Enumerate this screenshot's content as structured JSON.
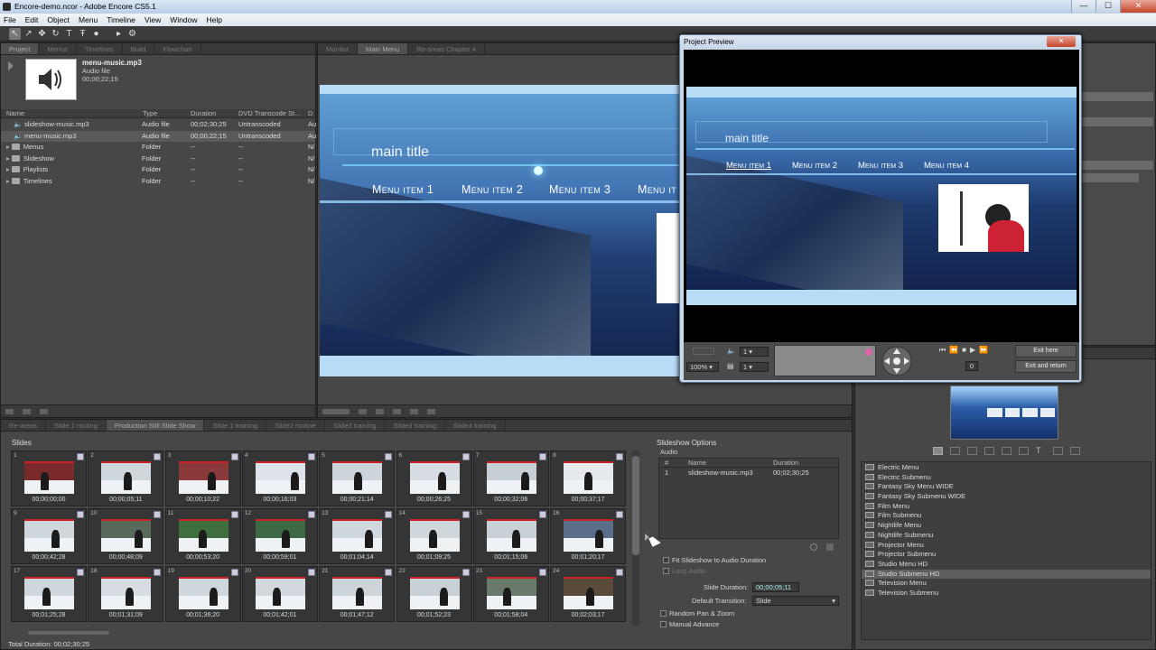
{
  "window": {
    "title": "Encore-demo.ncor - Adobe Encore CS5.1",
    "minimize": "—",
    "maximize": "☐",
    "close": "✕"
  },
  "menu": [
    "File",
    "Edit",
    "Object",
    "Menu",
    "Timeline",
    "View",
    "Window",
    "Help"
  ],
  "project_panel": {
    "tabs": [
      "Project",
      "Menus",
      "Timelines",
      "Build",
      "Flowchart"
    ],
    "selected": {
      "name": "menu-music.mp3",
      "type": "Audio file",
      "duration": "00;00;22;15"
    },
    "columns": [
      "Name",
      "Type",
      "Duration",
      "DVD Transcode St...",
      "D"
    ],
    "rows": [
      {
        "name": "slideshow-music.mp3",
        "type": "Audio file",
        "duration": "00;02;30;25",
        "transcode": "Untranscoded",
        "d": "Au",
        "icon": "speaker",
        "selected": false
      },
      {
        "name": "menu-music.mp3",
        "type": "Audio file",
        "duration": "00;00;22;15",
        "transcode": "Untranscoded",
        "d": "Au",
        "icon": "speaker",
        "selected": true
      },
      {
        "name": "Menus",
        "type": "Folder",
        "duration": "--",
        "transcode": "--",
        "d": "N/",
        "icon": "folder",
        "selected": false
      },
      {
        "name": "Slideshow",
        "type": "Folder",
        "duration": "--",
        "transcode": "--",
        "d": "N/",
        "icon": "folder",
        "selected": false
      },
      {
        "name": "Playlists",
        "type": "Folder",
        "duration": "--",
        "transcode": "--",
        "d": "N/",
        "icon": "folder",
        "selected": false
      },
      {
        "name": "Timelines",
        "type": "Folder",
        "duration": "--",
        "transcode": "--",
        "d": "N/",
        "icon": "folder",
        "selected": false
      }
    ]
  },
  "monitor_panel": {
    "tabs": [
      "Monitor",
      "Main Menu",
      "Re-areas Chapter 4"
    ],
    "menu_title": "main title",
    "menu_items": [
      "Menu item 1",
      "Menu item 2",
      "Menu item 3",
      "Menu it"
    ]
  },
  "project_preview": {
    "title": "Project Preview",
    "close": "✕",
    "menu_title": "main title",
    "menu_items": [
      "Menu item 1",
      "Menu item 2",
      "Menu item 3",
      "Menu item 4"
    ],
    "zoom": "100%",
    "audio_track": "1",
    "subtitle_track": "1",
    "chapter": "0",
    "exit_here": "Exit here",
    "exit_return": "Exit and return"
  },
  "slideshow_panel": {
    "tabs": [
      "Re-areas",
      "Slide 1 routing",
      "Production Still Slide Show",
      "Slide 1 training",
      "Slide2 routine",
      "Slide2 training",
      "Slide3 training",
      "Slide4 training"
    ],
    "heading": "Slides",
    "slides": [
      {
        "n": "1",
        "tc": "00;00;00;00"
      },
      {
        "n": "2",
        "tc": "00;00;05;11"
      },
      {
        "n": "3",
        "tc": "00;00;10;22"
      },
      {
        "n": "4",
        "tc": "00;00;16;03"
      },
      {
        "n": "5",
        "tc": "00;00;21;14"
      },
      {
        "n": "6",
        "tc": "00;00;26;25"
      },
      {
        "n": "7",
        "tc": "00;00;32;06"
      },
      {
        "n": "8",
        "tc": "00;00;37;17"
      },
      {
        "n": "9",
        "tc": "00;00;42;28"
      },
      {
        "n": "10",
        "tc": "00;00;48;09"
      },
      {
        "n": "11",
        "tc": "00;00;53;20"
      },
      {
        "n": "12",
        "tc": "00;00;59;01"
      },
      {
        "n": "13",
        "tc": "00;01;04;14"
      },
      {
        "n": "14",
        "tc": "00;01;09;25"
      },
      {
        "n": "15",
        "tc": "00;01;15;06"
      },
      {
        "n": "16",
        "tc": "00;01;20;17"
      },
      {
        "n": "17",
        "tc": "00;01;25;28"
      },
      {
        "n": "18",
        "tc": "00;01;31;09"
      },
      {
        "n": "19",
        "tc": "00;01;36;20"
      },
      {
        "n": "20",
        "tc": "00;01;42;01"
      },
      {
        "n": "21",
        "tc": "00;01;47;12"
      },
      {
        "n": "22",
        "tc": "00;01;52;23"
      },
      {
        "n": "23",
        "tc": "00;01;58;04"
      },
      {
        "n": "24",
        "tc": "00;02;03;17"
      }
    ],
    "total_duration": "Total Duration: 00;02;30;25",
    "options": {
      "title": "Slideshow Options",
      "audio_label": "Audio",
      "columns": [
        "#",
        "Name",
        "Duration"
      ],
      "audio_rows": [
        {
          "n": "1",
          "name": "slideshow-music.mp3",
          "duration": "00;02;30;25"
        }
      ],
      "fit_label": "Fit Slideshow to Audio Duration",
      "loop_label": "Loop Audio",
      "slide_duration_label": "Slide Duration:",
      "slide_duration": "00;00;05;11",
      "default_transition_label": "Default Transition:",
      "default_transition": "Slide",
      "random_pan_label": "Random Pan & Zoom",
      "manual_advance_label": "Manual Advance"
    }
  },
  "library_panel": {
    "items": [
      "Electric Menu",
      "Electric Submenu",
      "Fantasy Sky Menu WIDE",
      "Fantasy Sky Submenu WIDE",
      "Film Menu",
      "Film Submenu",
      "Nightlife Menu",
      "Nightlife Submenu",
      "Projector Menu",
      "Projector Submenu",
      "Studio Menu HD",
      "Studio Submenu HD",
      "Television Menu",
      "Television Submenu"
    ],
    "selected_index": 11
  },
  "colors": {
    "accent_blue": "#4c8fd4",
    "panel": "#474747",
    "dark": "#2f2f2f"
  }
}
